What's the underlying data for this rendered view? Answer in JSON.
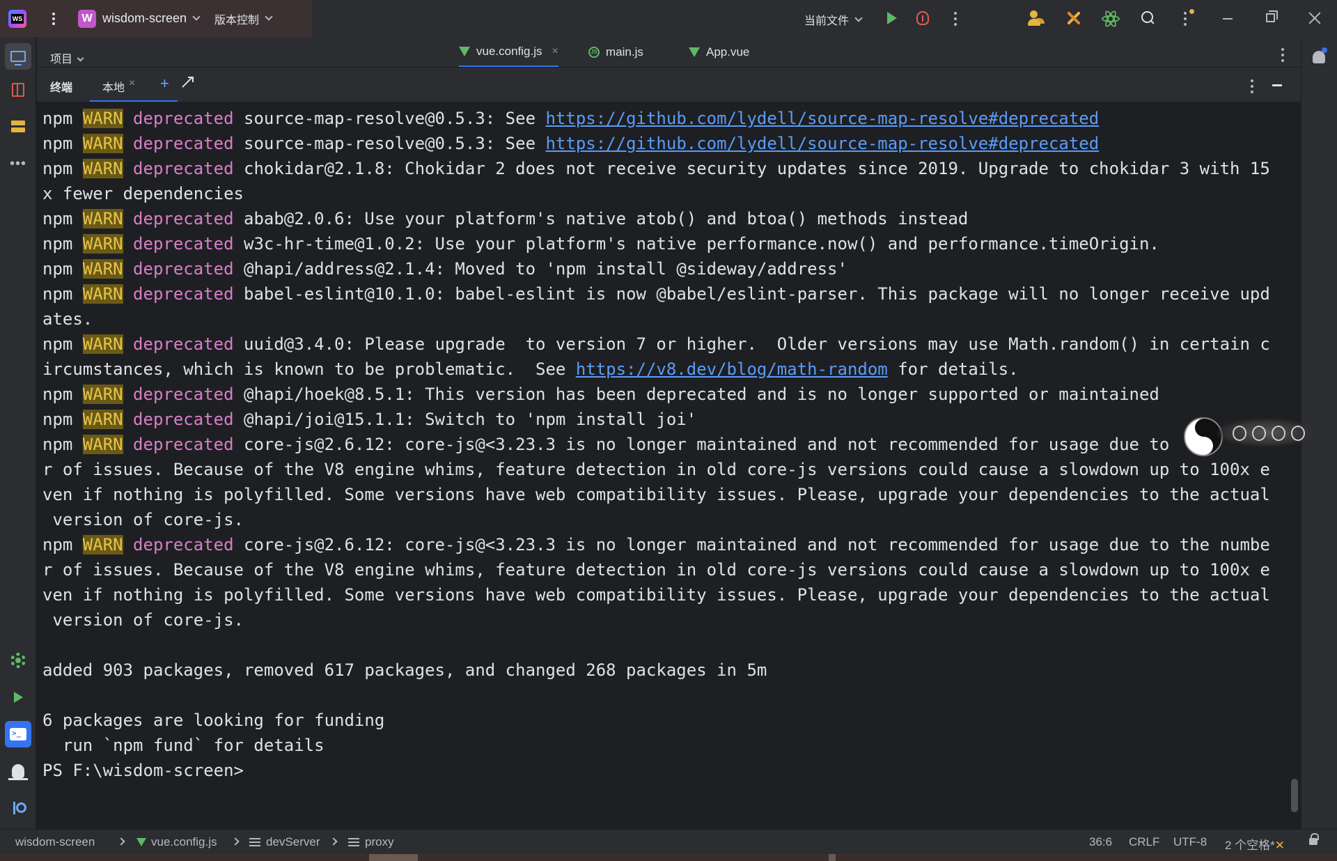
{
  "titlebar": {
    "project_badge": "W",
    "project_name": "wisdom-screen",
    "vcs_label": "版本控制",
    "run_config": "当前文件"
  },
  "editor_header": {
    "project_label": "项目",
    "tabs": [
      {
        "label": "vue.config.js",
        "icon": "vue-icon",
        "selected": true
      },
      {
        "label": "main.js",
        "icon": "js-icon",
        "selected": false
      },
      {
        "label": "App.vue",
        "icon": "vue-icon",
        "selected": false
      }
    ]
  },
  "terminal_header": {
    "title": "终端",
    "tab_label": "本地",
    "close_glyph": "×",
    "add_glyph": "+"
  },
  "terminal": {
    "lines": [
      [
        {
          "t": "npm "
        },
        {
          "t": "WARN",
          "c": "warn"
        },
        {
          "t": " "
        },
        {
          "t": "deprecated",
          "c": "dep"
        },
        {
          "t": " source-map-resolve@0.5.3: See "
        },
        {
          "t": "https://github.com/lydell/source-map-resolve#deprecated",
          "c": "link"
        }
      ],
      [
        {
          "t": "npm "
        },
        {
          "t": "WARN",
          "c": "warn"
        },
        {
          "t": " "
        },
        {
          "t": "deprecated",
          "c": "dep"
        },
        {
          "t": " source-map-resolve@0.5.3: See "
        },
        {
          "t": "https://github.com/lydell/source-map-resolve#deprecated",
          "c": "link"
        }
      ],
      [
        {
          "t": "npm "
        },
        {
          "t": "WARN",
          "c": "warn"
        },
        {
          "t": " "
        },
        {
          "t": "deprecated",
          "c": "dep"
        },
        {
          "t": " chokidar@2.1.8: Chokidar 2 does not receive security updates since 2019. Upgrade to chokidar 3 with 15"
        }
      ],
      [
        {
          "t": "x fewer dependencies"
        }
      ],
      [
        {
          "t": "npm "
        },
        {
          "t": "WARN",
          "c": "warn"
        },
        {
          "t": " "
        },
        {
          "t": "deprecated",
          "c": "dep"
        },
        {
          "t": " abab@2.0.6: Use your platform's native atob() and btoa() methods instead"
        }
      ],
      [
        {
          "t": "npm "
        },
        {
          "t": "WARN",
          "c": "warn"
        },
        {
          "t": " "
        },
        {
          "t": "deprecated",
          "c": "dep"
        },
        {
          "t": " w3c-hr-time@1.0.2: Use your platform's native performance.now() and performance.timeOrigin."
        }
      ],
      [
        {
          "t": "npm "
        },
        {
          "t": "WARN",
          "c": "warn"
        },
        {
          "t": " "
        },
        {
          "t": "deprecated",
          "c": "dep"
        },
        {
          "t": " @hapi/address@2.1.4: Moved to 'npm install @sideway/address'"
        }
      ],
      [
        {
          "t": "npm "
        },
        {
          "t": "WARN",
          "c": "warn"
        },
        {
          "t": " "
        },
        {
          "t": "deprecated",
          "c": "dep"
        },
        {
          "t": " babel-eslint@10.1.0: babel-eslint is now @babel/eslint-parser. This package will no longer receive upd"
        }
      ],
      [
        {
          "t": "ates."
        }
      ],
      [
        {
          "t": "npm "
        },
        {
          "t": "WARN",
          "c": "warn"
        },
        {
          "t": " "
        },
        {
          "t": "deprecated",
          "c": "dep"
        },
        {
          "t": " uuid@3.4.0: Please upgrade  to version 7 or higher.  Older versions may use Math.random() in certain c"
        }
      ],
      [
        {
          "t": "ircumstances, which is known to be problematic.  See "
        },
        {
          "t": "https://v8.dev/blog/math-random",
          "c": "link"
        },
        {
          "t": " for details."
        }
      ],
      [
        {
          "t": "npm "
        },
        {
          "t": "WARN",
          "c": "warn"
        },
        {
          "t": " "
        },
        {
          "t": "deprecated",
          "c": "dep"
        },
        {
          "t": " @hapi/hoek@8.5.1: This version has been deprecated and is no longer supported or maintained"
        }
      ],
      [
        {
          "t": "npm "
        },
        {
          "t": "WARN",
          "c": "warn"
        },
        {
          "t": " "
        },
        {
          "t": "deprecated",
          "c": "dep"
        },
        {
          "t": " @hapi/joi@15.1.1: Switch to 'npm install joi'"
        }
      ],
      [
        {
          "t": "npm "
        },
        {
          "t": "WARN",
          "c": "warn"
        },
        {
          "t": " "
        },
        {
          "t": "deprecated",
          "c": "dep"
        },
        {
          "t": " core-js@2.6.12: core-js@<3.23.3 is no longer maintained and not recommended for usage due to"
        }
      ],
      [
        {
          "t": "r of issues. Because of the V8 engine whims, feature detection in old core-js versions could cause a slowdown up to 100x e"
        }
      ],
      [
        {
          "t": "ven if nothing is polyfilled. Some versions have web compatibility issues. Please, upgrade your dependencies to the actual"
        }
      ],
      [
        {
          "t": " version of core-js."
        }
      ],
      [
        {
          "t": "npm "
        },
        {
          "t": "WARN",
          "c": "warn"
        },
        {
          "t": " "
        },
        {
          "t": "deprecated",
          "c": "dep"
        },
        {
          "t": " core-js@2.6.12: core-js@<3.23.3 is no longer maintained and not recommended for usage due to the numbe"
        }
      ],
      [
        {
          "t": "r of issues. Because of the V8 engine whims, feature detection in old core-js versions could cause a slowdown up to 100x e"
        }
      ],
      [
        {
          "t": "ven if nothing is polyfilled. Some versions have web compatibility issues. Please, upgrade your dependencies to the actual"
        }
      ],
      [
        {
          "t": " version of core-js."
        }
      ],
      [
        {
          "t": ""
        }
      ],
      [
        {
          "t": "added 903 packages, removed 617 packages, and changed 268 packages in 5m"
        }
      ],
      [
        {
          "t": ""
        }
      ],
      [
        {
          "t": "6 packages are looking for funding"
        }
      ],
      [
        {
          "t": "  run `npm fund` for details"
        }
      ],
      [
        {
          "t": "PS F:\\wisdom-screen>"
        }
      ]
    ]
  },
  "statusbar": {
    "breadcrumbs": [
      "wisdom-screen",
      "vue.config.js",
      "devServer",
      "proxy"
    ],
    "position": "36:6",
    "line_ending": "CRLF",
    "encoding": "UTF-8",
    "indent": "2 个空格*"
  },
  "colors": {
    "warn_bg": "#6b5a16",
    "warn_fg": "#e6c44a",
    "deprecated": "#d97ec8",
    "link": "#5a9cf8",
    "accent": "#3574f0"
  }
}
